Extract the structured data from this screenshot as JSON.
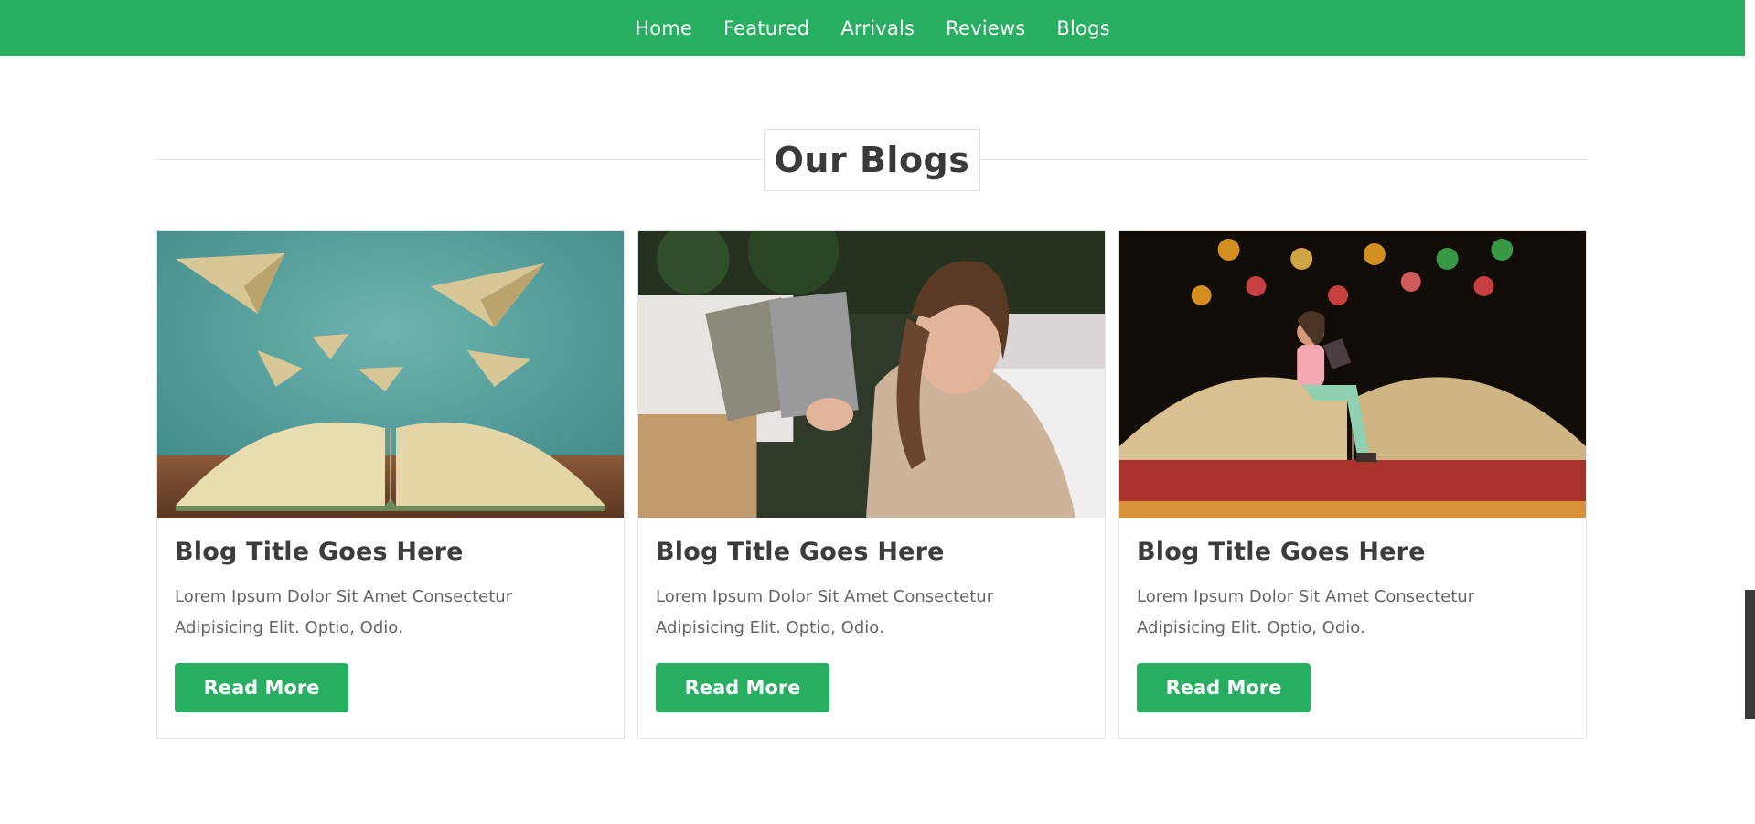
{
  "nav": {
    "items": [
      "Home",
      "Featured",
      "Arrivals",
      "Reviews",
      "Blogs"
    ]
  },
  "section": {
    "title": "Our Blogs"
  },
  "blogs": [
    {
      "title": "Blog Title Goes Here",
      "text": "Lorem Ipsum Dolor Sit Amet Consectetur Adipisicing Elit. Optio, Odio.",
      "button": "Read More",
      "image_subject": "open book with paper planes on teal background"
    },
    {
      "title": "Blog Title Goes Here",
      "text": "Lorem Ipsum Dolor Sit Amet Consectetur Adipisicing Elit. Optio, Odio.",
      "button": "Read More",
      "image_subject": "smiling woman holding books among gifts"
    },
    {
      "title": "Blog Title Goes Here",
      "text": "Lorem Ipsum Dolor Sit Amet Consectetur Adipisicing Elit. Optio, Odio.",
      "button": "Read More",
      "image_subject": "paper figure reading on open book with bokeh lights"
    }
  ],
  "colors": {
    "brand": "#27ae60",
    "heading": "#3a3a3a",
    "text": "#666666"
  }
}
